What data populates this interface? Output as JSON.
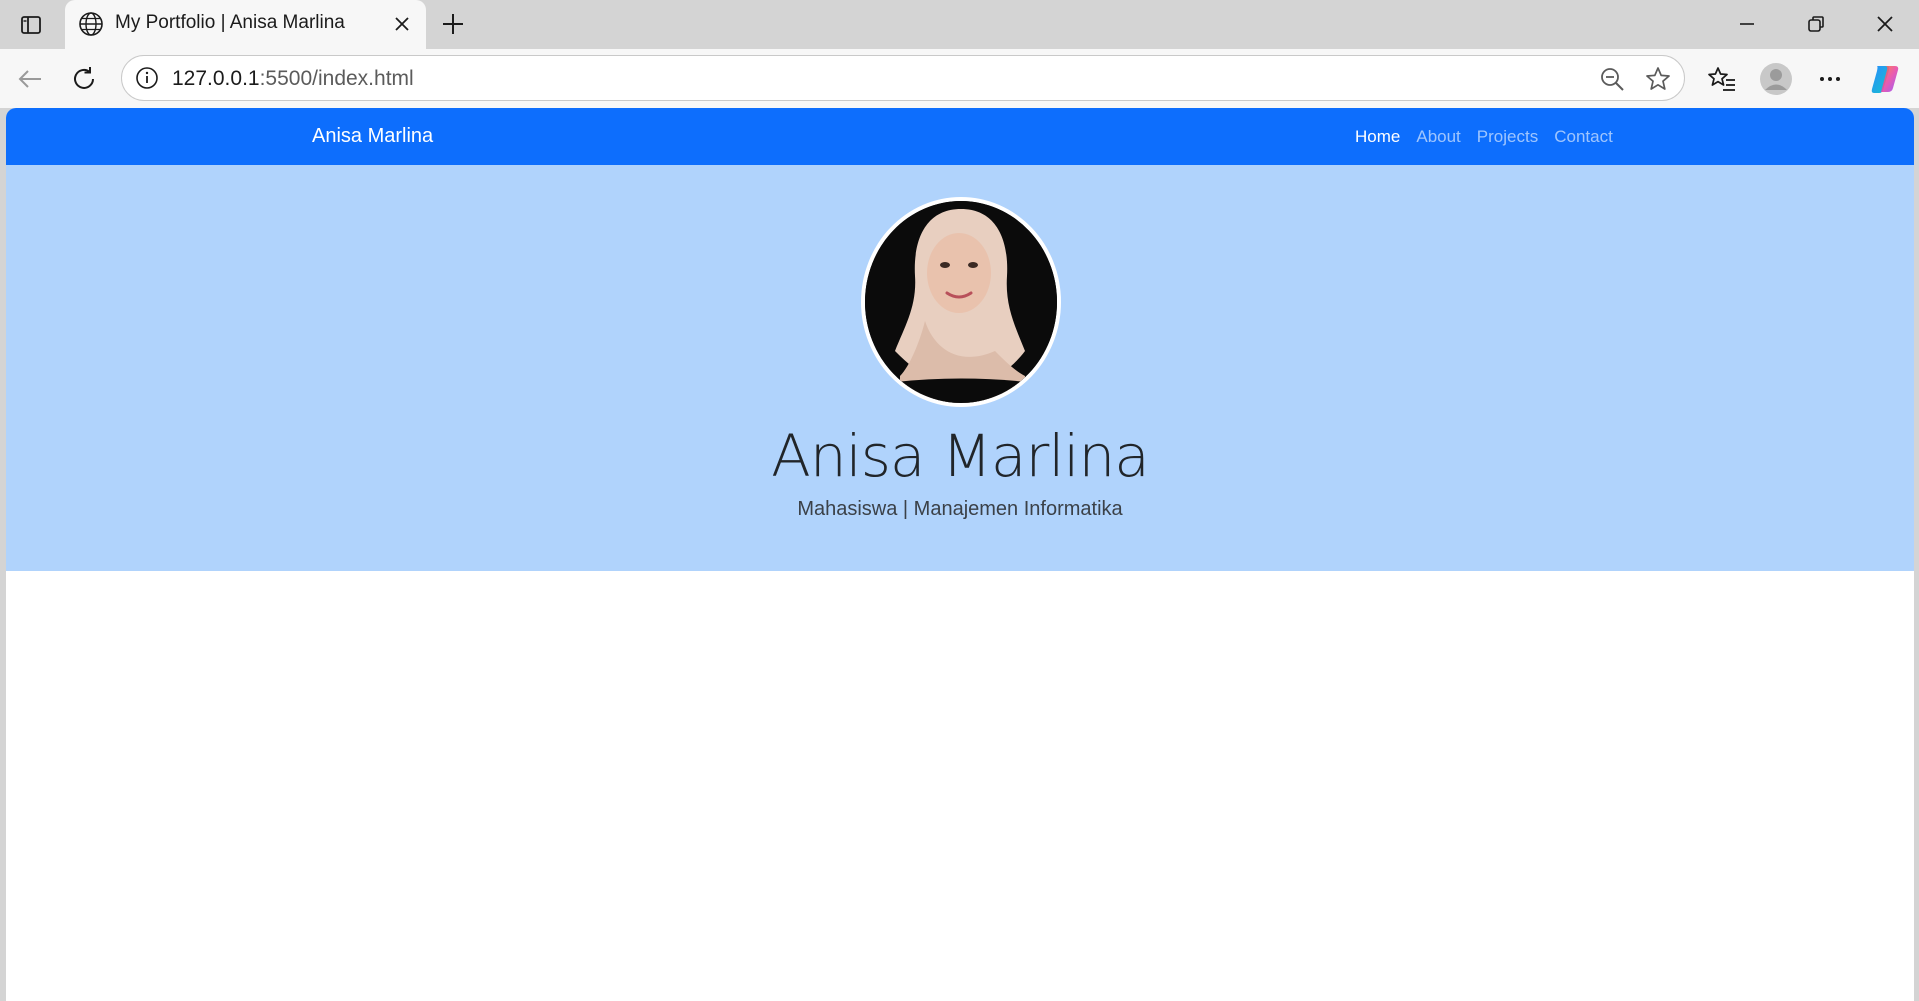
{
  "browser": {
    "tab_title": "My Portfolio | Anisa Marlina",
    "url_host": "127.0.0.1",
    "url_rest": ":5500/index.html"
  },
  "site": {
    "brand": "Anisa Marlina",
    "nav": [
      {
        "label": "Home",
        "active": true
      },
      {
        "label": "About",
        "active": false
      },
      {
        "label": "Projects",
        "active": false
      },
      {
        "label": "Contact",
        "active": false
      }
    ]
  },
  "hero": {
    "name": "Anisa Marlina",
    "subtitle": "Mahasiswa | Manajemen Informatika",
    "background": "#b0d3fc"
  },
  "colors": {
    "navbar": "#0d6efd",
    "page_bg": "#ffffff"
  },
  "icons": [
    "sidebar-toggle-icon",
    "globe-icon",
    "close-icon",
    "plus-icon",
    "minimize-icon",
    "restore-icon",
    "back-arrow-icon",
    "refresh-icon",
    "info-icon",
    "zoom-out-icon",
    "star-icon",
    "favorites-icon",
    "profile-icon",
    "more-icon",
    "copilot-icon"
  ]
}
